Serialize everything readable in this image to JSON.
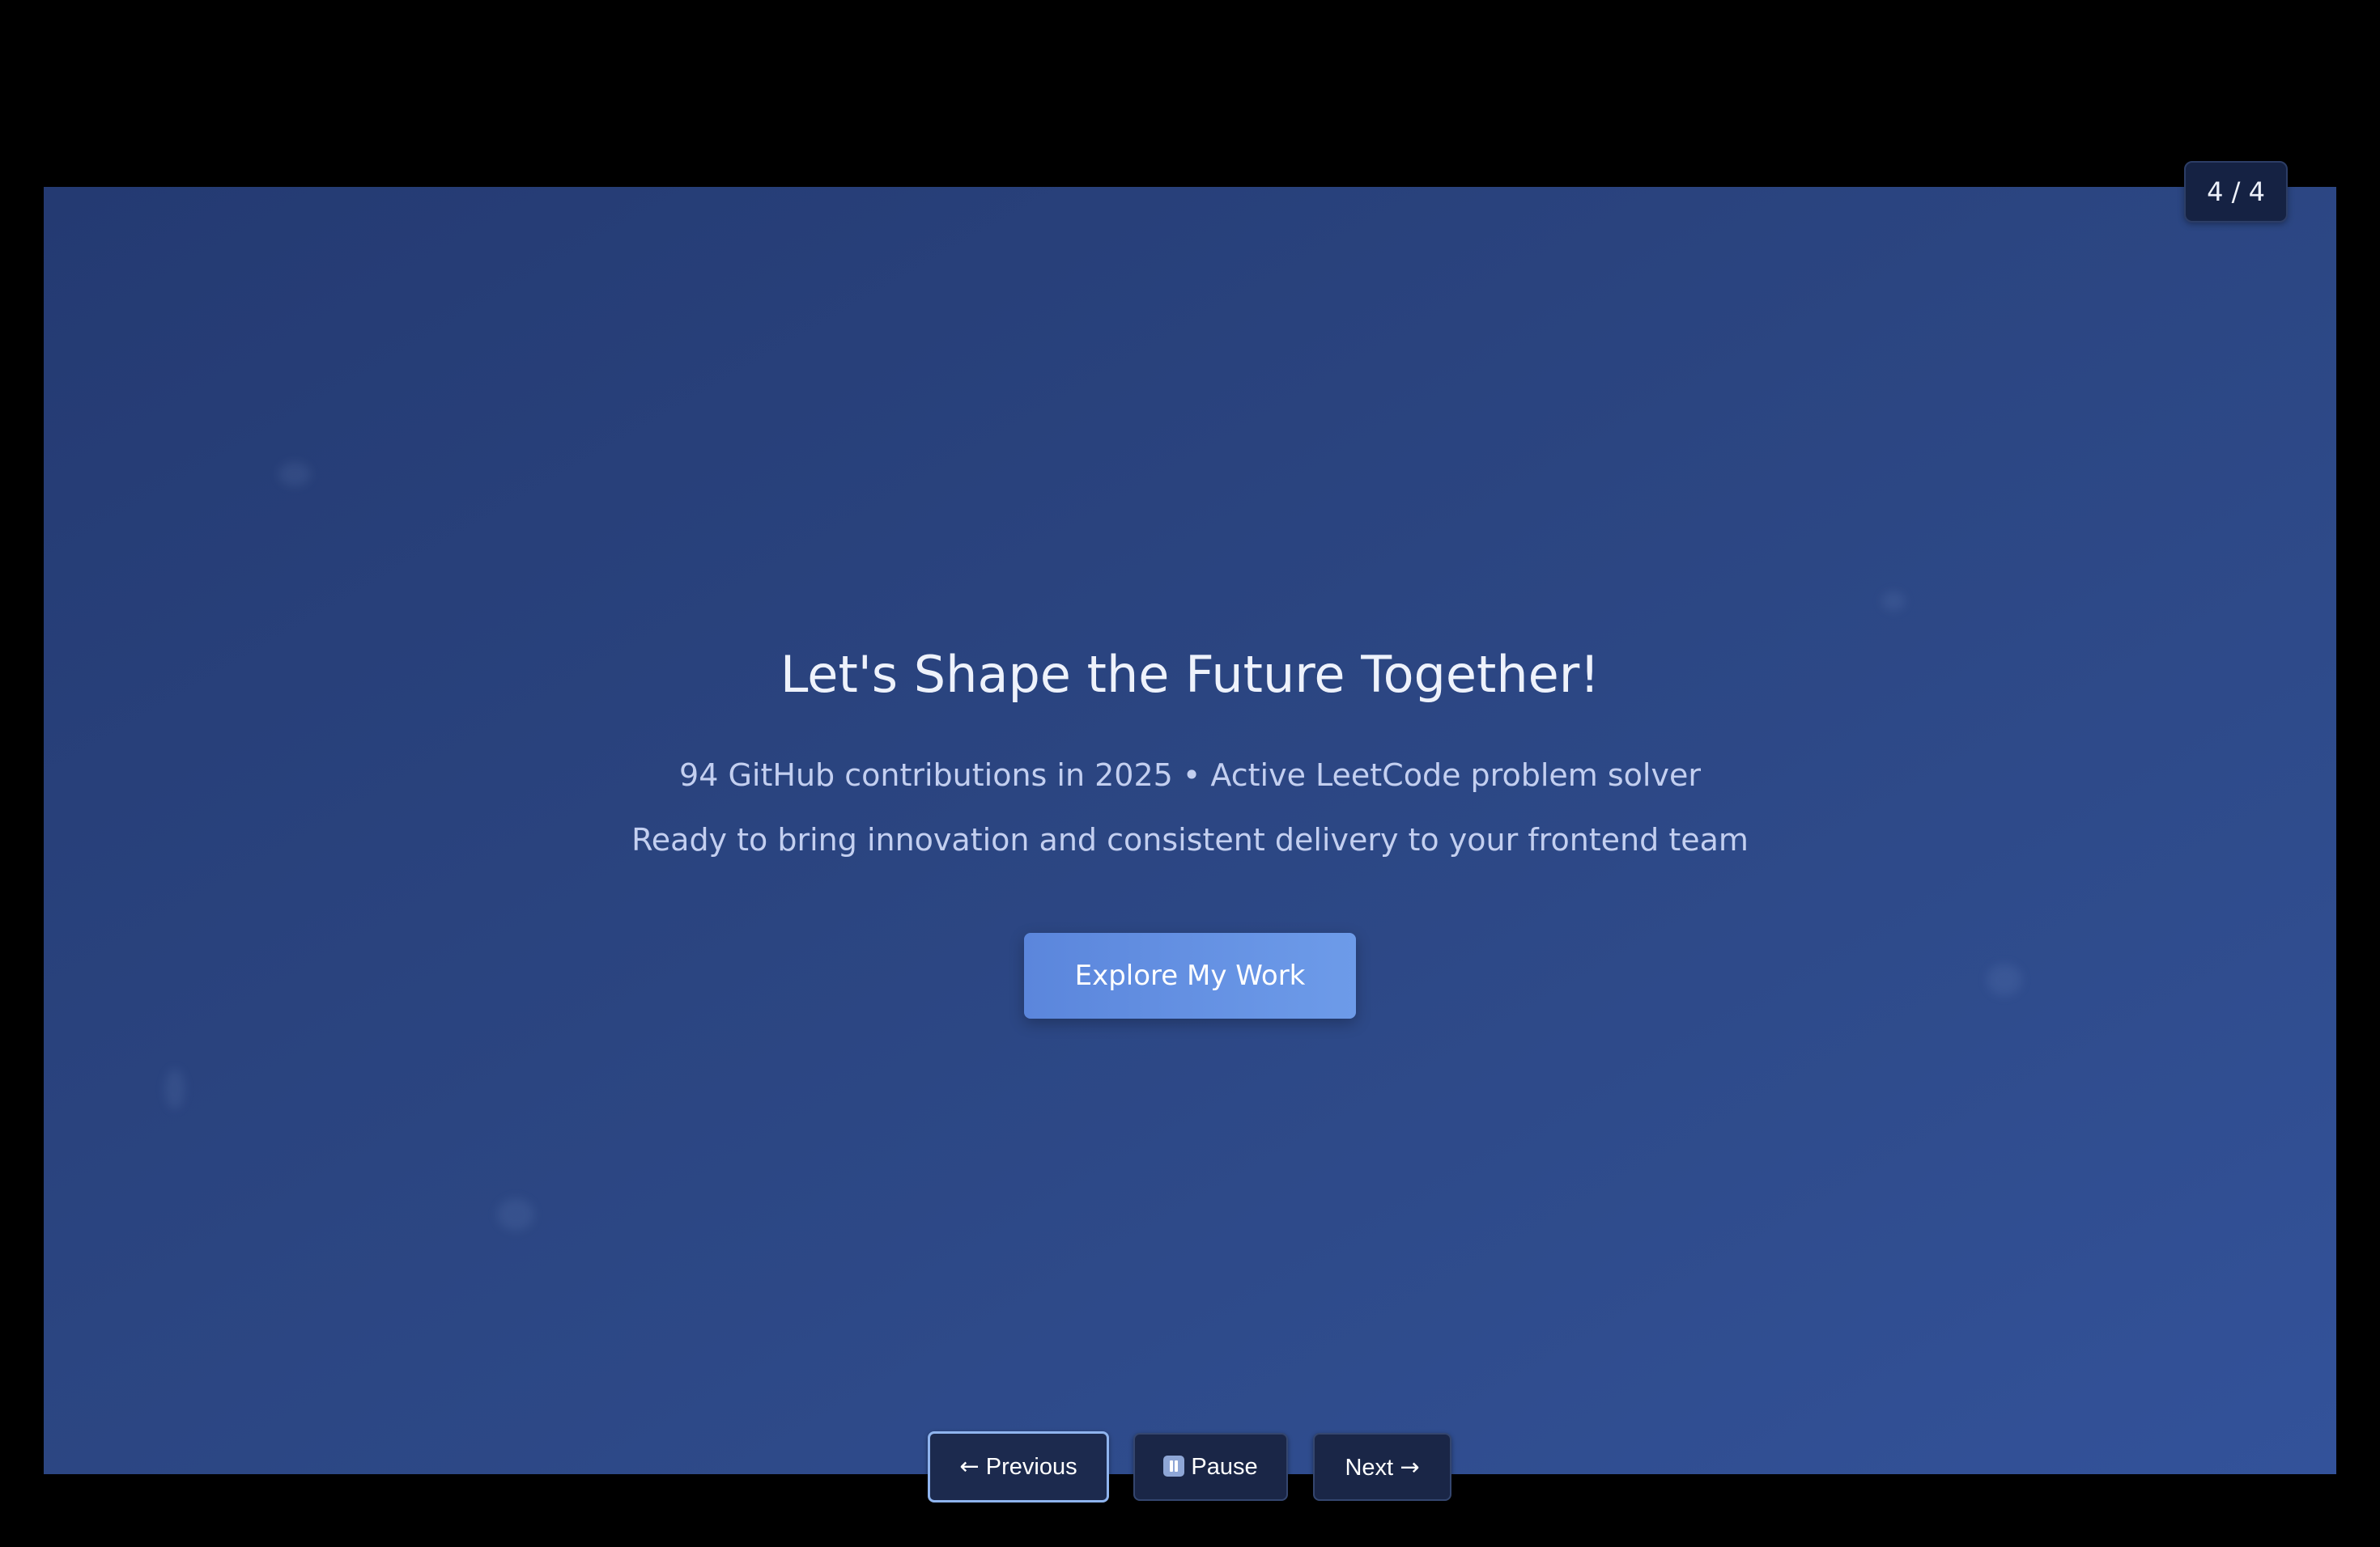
{
  "slide": {
    "counter": "4 / 4",
    "title": "Let's Shape the Future Together!",
    "subtitle_line1": "94 GitHub contributions in 2025 • Active LeetCode problem solver",
    "subtitle_line2": "Ready to bring innovation and consistent delivery to your frontend team",
    "cta_label": "Explore My Work",
    "current": 4,
    "total": 4
  },
  "controls": {
    "previous": {
      "arrow": "←",
      "label": "Previous"
    },
    "pause": {
      "label": "Pause",
      "icon": "pause-icon"
    },
    "next": {
      "label": "Next",
      "arrow": "→"
    }
  },
  "colors": {
    "background": "#000000",
    "slide": "#2b4581",
    "accent": "#6d9be9",
    "control_bg": "#1a2647",
    "focus_ring": "#8fb4ee"
  }
}
